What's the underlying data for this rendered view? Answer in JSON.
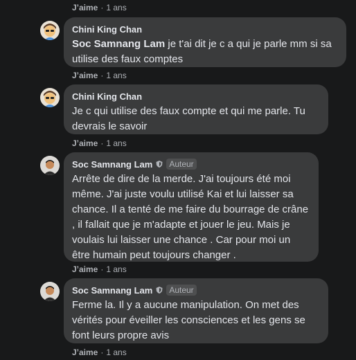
{
  "actions": {
    "like": "J’aime",
    "dot": "·"
  },
  "comments": [
    {
      "time": "1 ans"
    },
    {
      "author": "Chini King Chan",
      "mention": "Soc Samnang Lam",
      "text": " je t'ai dit je c a qui je parle mm si sa utilise des faux comptes",
      "time": "1 ans"
    },
    {
      "author": "Chini King Chan",
      "text": "Je c qui utilise des faux compte et qui me parle. Tu devrais le savoir",
      "time": "1 ans"
    },
    {
      "author": "Soc Samnang Lam",
      "badge": "Auteur",
      "text": "Arrête de dire de la merde. J'ai toujours été moi même. J'ai juste voulu utilisé Kai et lui laisser sa chance. Il a tenté de me faire du bourrage de crâne , il fallait que je m'adapte et jouer le jeu. Mais je voulais lui laisser une chance . Car pour moi un être humain peut toujours changer .",
      "time": "1 ans"
    },
    {
      "author": "Soc Samnang Lam",
      "badge": "Auteur",
      "text": "Ferme la. Il y a aucune manipulation. On met des vérités pour éveiller les consciences et les gens se font leurs propre avis",
      "time": "1 ans"
    }
  ],
  "colors": {
    "background": "#18191a",
    "bubble": "#3a3b3c",
    "text": "#e4e6eb",
    "muted": "#b0b3b8"
  }
}
